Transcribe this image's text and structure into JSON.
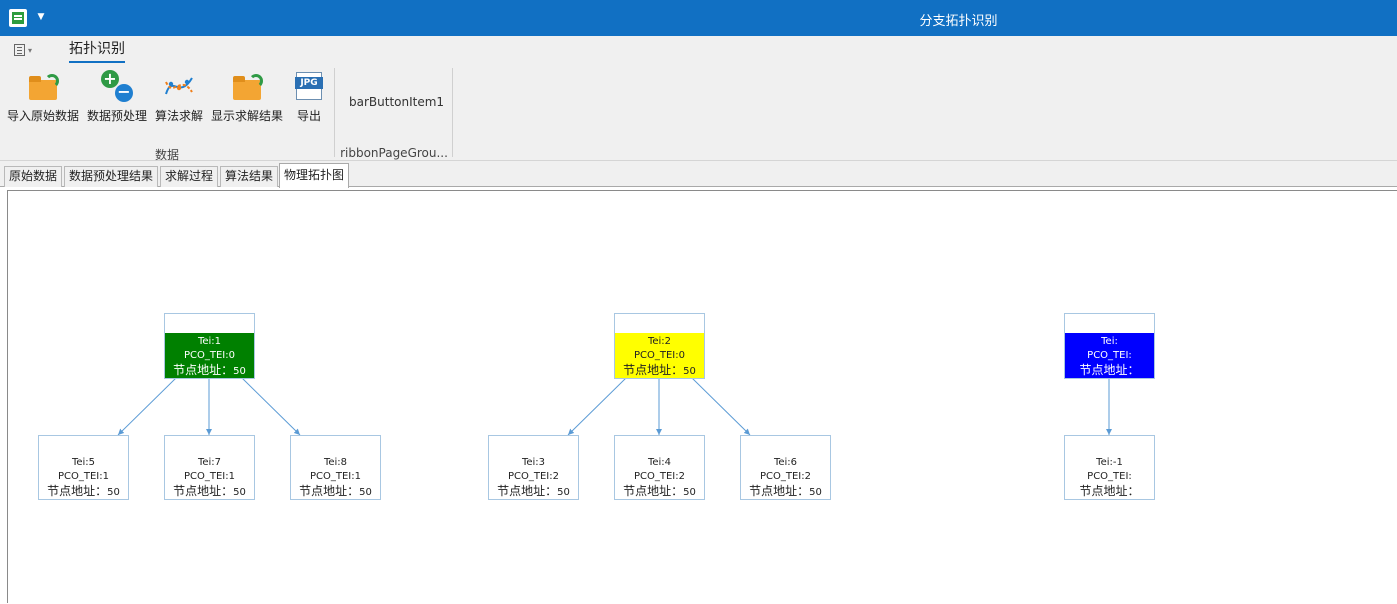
{
  "window": {
    "title": "分支拓扑识别"
  },
  "ribbon": {
    "active_tab": "拓扑识别",
    "buttons": [
      {
        "label": "导入原始数据",
        "icon": "folder-import-icon"
      },
      {
        "label": "数据预处理",
        "icon": "add-remove-icon"
      },
      {
        "label": "算法求解",
        "icon": "curve-algorithm-icon"
      },
      {
        "label": "显示求解结果",
        "icon": "folder-result-icon"
      },
      {
        "label": "导出",
        "icon": "jpg-export-icon"
      }
    ],
    "jpg_badge": "JPG",
    "group1_label": "数据",
    "bar_button": "barButtonItem1",
    "group2_label": "ribbonPageGrou..."
  },
  "doc_tabs": [
    "原始数据",
    "数据预处理结果",
    "求解过程",
    "算法结果",
    "物理拓扑图"
  ],
  "topology": {
    "roots": [
      {
        "tei": "Tei:1",
        "pco": "PCO_TEI:0",
        "addr": "节点地址：",
        "addr_val": "50",
        "color": "#008000",
        "children": [
          {
            "tei": "Tei:5",
            "pco": "PCO_TEI:1",
            "addr": "节点地址：",
            "addr_val": "50"
          },
          {
            "tei": "Tei:7",
            "pco": "PCO_TEI:1",
            "addr": "节点地址：",
            "addr_val": "50"
          },
          {
            "tei": "Tei:8",
            "pco": "PCO_TEI:1",
            "addr": "节点地址：",
            "addr_val": "50"
          }
        ]
      },
      {
        "tei": "Tei:2",
        "pco": "PCO_TEI:0",
        "addr": "节点地址：",
        "addr_val": "50",
        "color": "#ffff00",
        "children": [
          {
            "tei": "Tei:3",
            "pco": "PCO_TEI:2",
            "addr": "节点地址：",
            "addr_val": "50"
          },
          {
            "tei": "Tei:4",
            "pco": "PCO_TEI:2",
            "addr": "节点地址：",
            "addr_val": "50"
          },
          {
            "tei": "Tei:6",
            "pco": "PCO_TEI:2",
            "addr": "节点地址：",
            "addr_val": "50"
          }
        ]
      },
      {
        "tei": "Tei:",
        "pco": "PCO_TEI:",
        "addr": "节点地址：",
        "addr_val": "",
        "color": "#0000ff",
        "children": [
          {
            "tei": "Tei:-1",
            "pco": "PCO_TEI:",
            "addr": "节点地址：",
            "addr_val": ""
          }
        ]
      }
    ]
  }
}
